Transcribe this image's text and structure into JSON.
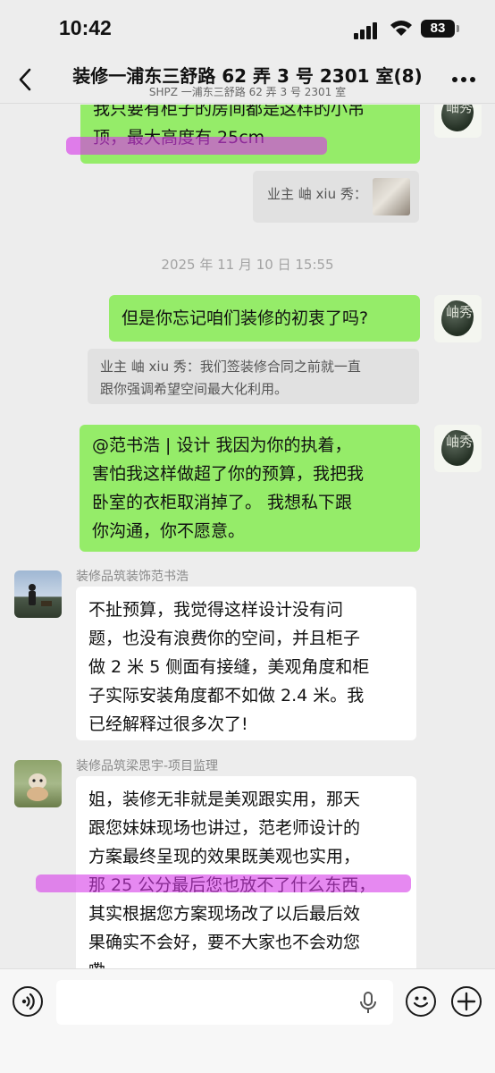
{
  "status_bar": {
    "time": "10:42",
    "battery": "83"
  },
  "nav": {
    "title": "装修一浦东三舒路 62 弄 3 号 2301 室(8)",
    "subtitle": "SHPZ 一浦东三舒路 62 弄 3 号 2301 室"
  },
  "messages": {
    "m1_lines": [
      "我只要有柜子的房间都是这样的小吊",
      "顶，最大高度有 25cm"
    ],
    "m1_quote_label": "业主 岫 xiu 秀：",
    "timestamp": "2025 年 11 月 10 日 15:55",
    "m2_text": "但是你忘记咱们装修的初衷了吗?",
    "m2_quote_lines": [
      "业主 岫 xiu 秀：我们签装修合同之前就一直",
      "跟你强调希望空间最大化利用。"
    ],
    "m3_lines": [
      "@范书浩 | 设计 我因为你的执着，",
      "害怕我这样做超了你的预算，我把我",
      "卧室的衣柜取消掉了。 我想私下跟",
      "你沟通，你不愿意。"
    ],
    "m4_sender": "装修品筑装饰范书浩",
    "m4_lines": [
      "不扯预算，我觉得这样设计没有问",
      "题，也没有浪费你的空间，并且柜子",
      "做 2 米 5 侧面有接缝，美观角度和柜",
      "子实际安装角度都不如做 2.4 米。我",
      "已经解释过很多次了!"
    ],
    "m5_sender": "装修品筑梁思宇-项目监理",
    "m5_lines": [
      "姐，装修无非就是美观跟实用，那天",
      "跟您妹妹现场也讲过，范老师设计的",
      "方案最终呈现的效果既美观也实用，",
      "那 25 公分最后您也放不了什么东西，",
      "其实根据您方案现场改了以后最后效",
      "果确实不会好，要不大家也不会劝您",
      "嘞"
    ],
    "self_avatar_glyph": "岫秀"
  },
  "colors": {
    "bubble_green": "#95ec69",
    "highlight": "#d63ae7",
    "background": "#ededed"
  },
  "icons": [
    "back-chevron-icon",
    "more-icon",
    "voice-input-icon",
    "microphone-icon",
    "emoji-icon",
    "add-icon"
  ]
}
